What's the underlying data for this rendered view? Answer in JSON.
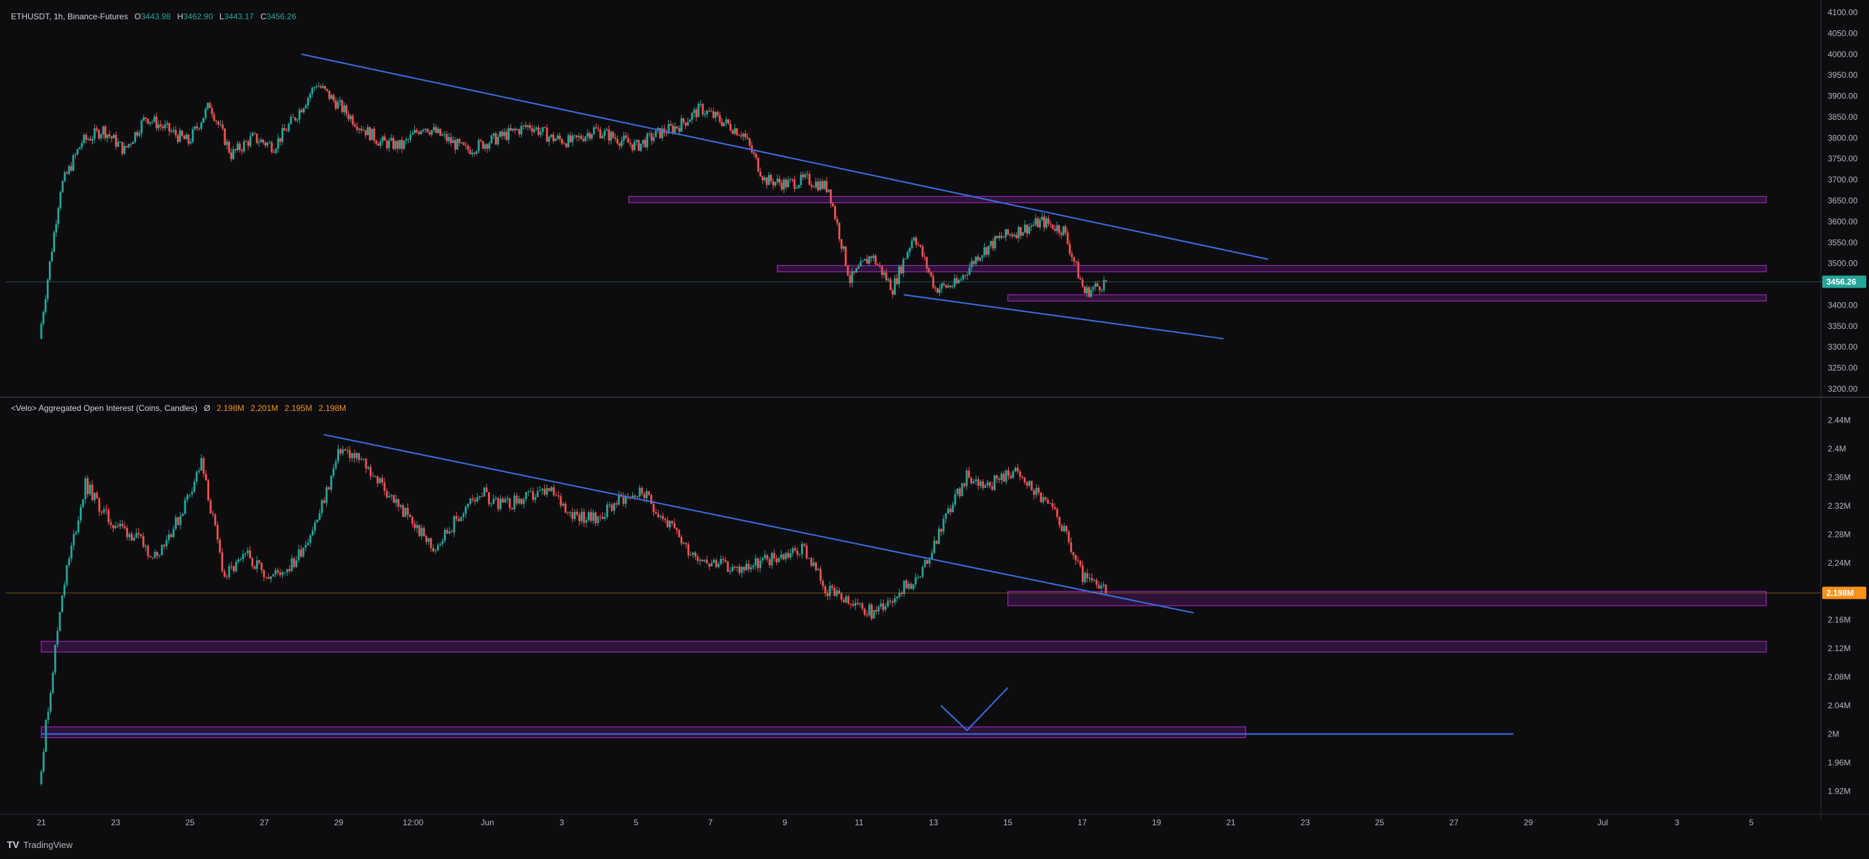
{
  "price_legend": {
    "symbol": "ETHUSDT, 1h, Binance-Futures",
    "o_label": "O",
    "o_value": "3443.98",
    "h_label": "H",
    "h_value": "3462.90",
    "l_label": "L",
    "l_value": "3443.17",
    "c_label": "C",
    "c_value": "3456.26"
  },
  "oi_legend": {
    "title": "<Velo> Aggregated Open Interest (Coins, Candles)",
    "symbol_sep": "Ø",
    "values": [
      "2.198M",
      "2.201M",
      "2.195M",
      "2.198M"
    ]
  },
  "footer": {
    "logo": "TV",
    "brand": "TradingView"
  },
  "colors": {
    "background": "#0d0d0f",
    "up": "#26a69a",
    "down": "#ef5350",
    "trendline": "#3b6fe0",
    "zone_border": "#9c27b0",
    "zone_fill": "#4a1a5c",
    "price_badge": "#26a69a",
    "oi_badge": "#f7931a"
  },
  "chart_data": [
    {
      "type": "candlestick",
      "name": "price-pane",
      "ylim": [
        3200,
        4100
      ],
      "yticks": [
        "4100.00",
        "4050.00",
        "4000.00",
        "3950.00",
        "3900.00",
        "3850.00",
        "3800.00",
        "3750.00",
        "3700.00",
        "3650.00",
        "3600.00",
        "3550.00",
        "3500.00",
        "3450.00",
        "3400.00",
        "3350.00",
        "3300.00",
        "3250.00",
        "3200.00"
      ],
      "current_value": "3456.26",
      "x_labels": [
        "21",
        "23",
        "25",
        "27",
        "29",
        "12:00",
        "Jun",
        "3",
        "5",
        "7",
        "9",
        "11",
        "13",
        "15",
        "17",
        "19",
        "21",
        "23",
        "25",
        "27",
        "29",
        "Jul",
        "3",
        "5"
      ],
      "closes": [
        3320,
        3680,
        3790,
        3820,
        3770,
        3850,
        3820,
        3790,
        3880,
        3760,
        3800,
        3780,
        3850,
        3930,
        3880,
        3830,
        3790,
        3780,
        3830,
        3800,
        3770,
        3790,
        3810,
        3830,
        3800,
        3790,
        3820,
        3800,
        3780,
        3810,
        3830,
        3870,
        3840,
        3810,
        3700,
        3690,
        3700,
        3680,
        3460,
        3520,
        3440,
        3570,
        3440,
        3450,
        3520,
        3560,
        3580,
        3600,
        3580,
        3430,
        3456
      ],
      "trendlines": [
        {
          "from": [
            4000,
            3.5
          ],
          "to": [
            3510,
            16.5
          ]
        },
        {
          "from": [
            3425,
            11.6
          ],
          "to": [
            3320,
            15.9
          ]
        }
      ],
      "zones": [
        {
          "top": 3660,
          "bottom": 3645,
          "x_from": 7.9,
          "x_to": 23.2
        },
        {
          "top": 3495,
          "bottom": 3480,
          "x_from": 9.9,
          "x_to": 23.2
        },
        {
          "top": 3425,
          "bottom": 3410,
          "x_from": 13.0,
          "x_to": 23.2
        }
      ]
    },
    {
      "type": "candlestick",
      "name": "open-interest-pane",
      "ylim": [
        1.9,
        2.46
      ],
      "yticks": [
        "2.44M",
        "2.4M",
        "2.36M",
        "2.32M",
        "2.28M",
        "2.24M",
        "2.2M",
        "2.16M",
        "2.12M",
        "2.08M",
        "2.04M",
        "2M",
        "1.96M",
        "1.92M"
      ],
      "current_value": "2.198M",
      "closes": [
        1.93,
        2.2,
        2.35,
        2.3,
        2.28,
        2.25,
        2.3,
        2.38,
        2.22,
        2.25,
        2.22,
        2.24,
        2.3,
        2.4,
        2.38,
        2.34,
        2.3,
        2.26,
        2.3,
        2.34,
        2.32,
        2.33,
        2.34,
        2.31,
        2.3,
        2.33,
        2.34,
        2.3,
        2.26,
        2.24,
        2.23,
        2.24,
        2.25,
        2.26,
        2.2,
        2.18,
        2.17,
        2.2,
        2.22,
        2.3,
        2.36,
        2.35,
        2.37,
        2.34,
        2.3,
        2.22,
        2.198
      ],
      "trendlines": [
        {
          "from": [
            2.42,
            3.8
          ],
          "to": [
            2.17,
            15.5
          ]
        },
        {
          "from": [
            2.04,
            12.1
          ],
          "to": [
            2.005,
            12.45
          ]
        },
        {
          "from": [
            2.005,
            12.45
          ],
          "to": [
            2.065,
            13.0
          ]
        },
        {
          "from": [
            2.0,
            0
          ],
          "to": [
            2.0,
            19.8
          ]
        }
      ],
      "zones": [
        {
          "top": 2.2,
          "bottom": 2.18,
          "x_from": 13.0,
          "x_to": 23.2
        },
        {
          "top": 2.13,
          "bottom": 2.115,
          "x_from": 0,
          "x_to": 23.2
        },
        {
          "top": 2.01,
          "bottom": 1.995,
          "x_from": 0,
          "x_to": 16.2
        }
      ]
    }
  ]
}
